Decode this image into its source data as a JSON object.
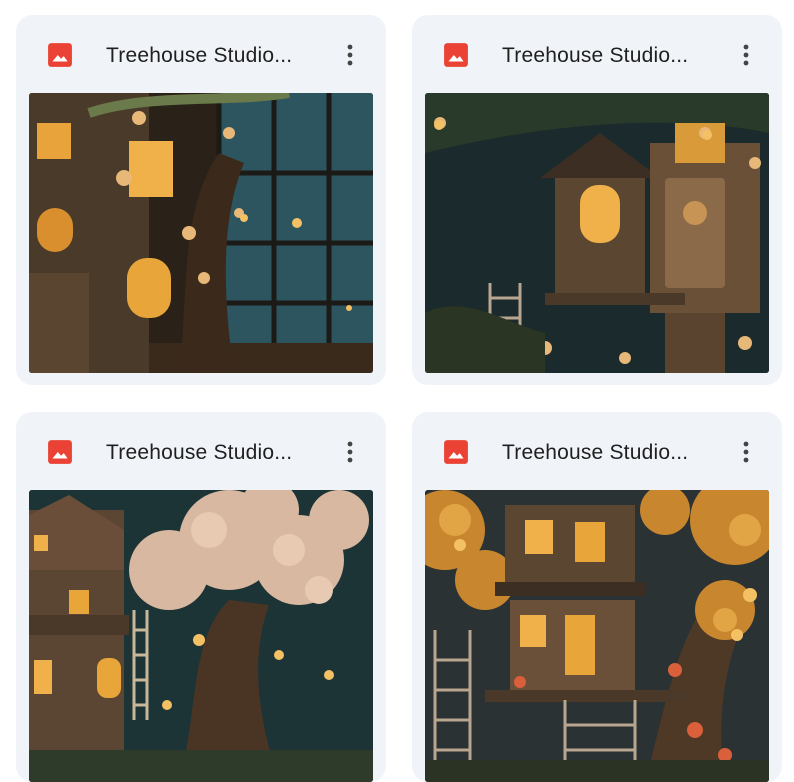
{
  "files": [
    {
      "title": "Treehouse Studio...",
      "file_icon": "image-file-icon",
      "menu_icon": "more-vert-icon"
    },
    {
      "title": "Treehouse Studio...",
      "file_icon": "image-file-icon",
      "menu_icon": "more-vert-icon"
    },
    {
      "title": "Treehouse Studio...",
      "file_icon": "image-file-icon",
      "menu_icon": "more-vert-icon"
    },
    {
      "title": "Treehouse Studio...",
      "file_icon": "image-file-icon",
      "menu_icon": "more-vert-icon"
    }
  ],
  "colors": {
    "card_bg": "#f0f4f9",
    "image_icon": "#ea4335",
    "title_text": "#1f1f1f"
  }
}
